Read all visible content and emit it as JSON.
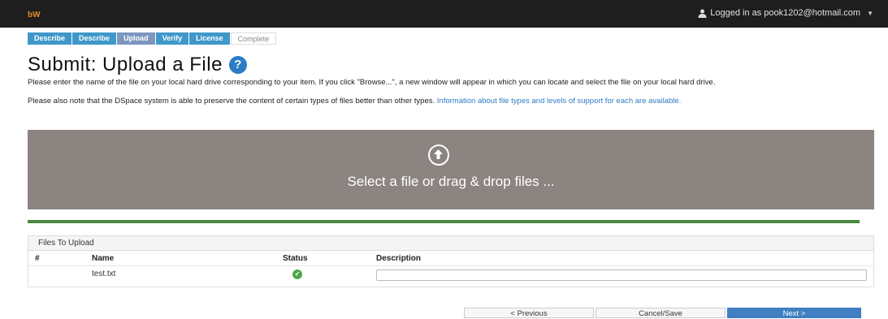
{
  "header": {
    "user_text": "Logged in as pook1202@hotmail.com"
  },
  "steps": [
    {
      "label": "Describe",
      "state": "done"
    },
    {
      "label": "Describe",
      "state": "done"
    },
    {
      "label": "Upload",
      "state": "active"
    },
    {
      "label": "Verify",
      "state": "done"
    },
    {
      "label": "License",
      "state": "done"
    },
    {
      "label": "Complete",
      "state": "inactive"
    }
  ],
  "page": {
    "title": "Submit: Upload a File",
    "help_glyph": "?",
    "para1": "Please enter the name of the file on your local hard drive corresponding to your item. If you click \"Browse...\", a new window will appear in which you can locate and select the file on your local hard drive.",
    "para2_text": "Please also note that the DSpace system is able to preserve the content of certain types of files better than other types. ",
    "para2_link": "Information about file types and levels of support for each are available."
  },
  "dropzone": {
    "text": "Select a file or drag & drop files ..."
  },
  "upload_progress": 1.0,
  "files_panel": {
    "title": "Files To Upload",
    "columns": [
      "#",
      "Name",
      "Status",
      "Description"
    ],
    "rows": [
      {
        "number": "",
        "name": "test.txt",
        "status": "success",
        "description": ""
      }
    ]
  },
  "buttons": {
    "previous": "< Previous",
    "cancel_save": "Cancel/Save",
    "next": "Next >"
  },
  "colors": {
    "step": "#3f98c9",
    "step_active": "#7d96bf",
    "dropzone": "#8c8480",
    "progress": "#4a8a3f",
    "primary": "#3f7fc2"
  }
}
